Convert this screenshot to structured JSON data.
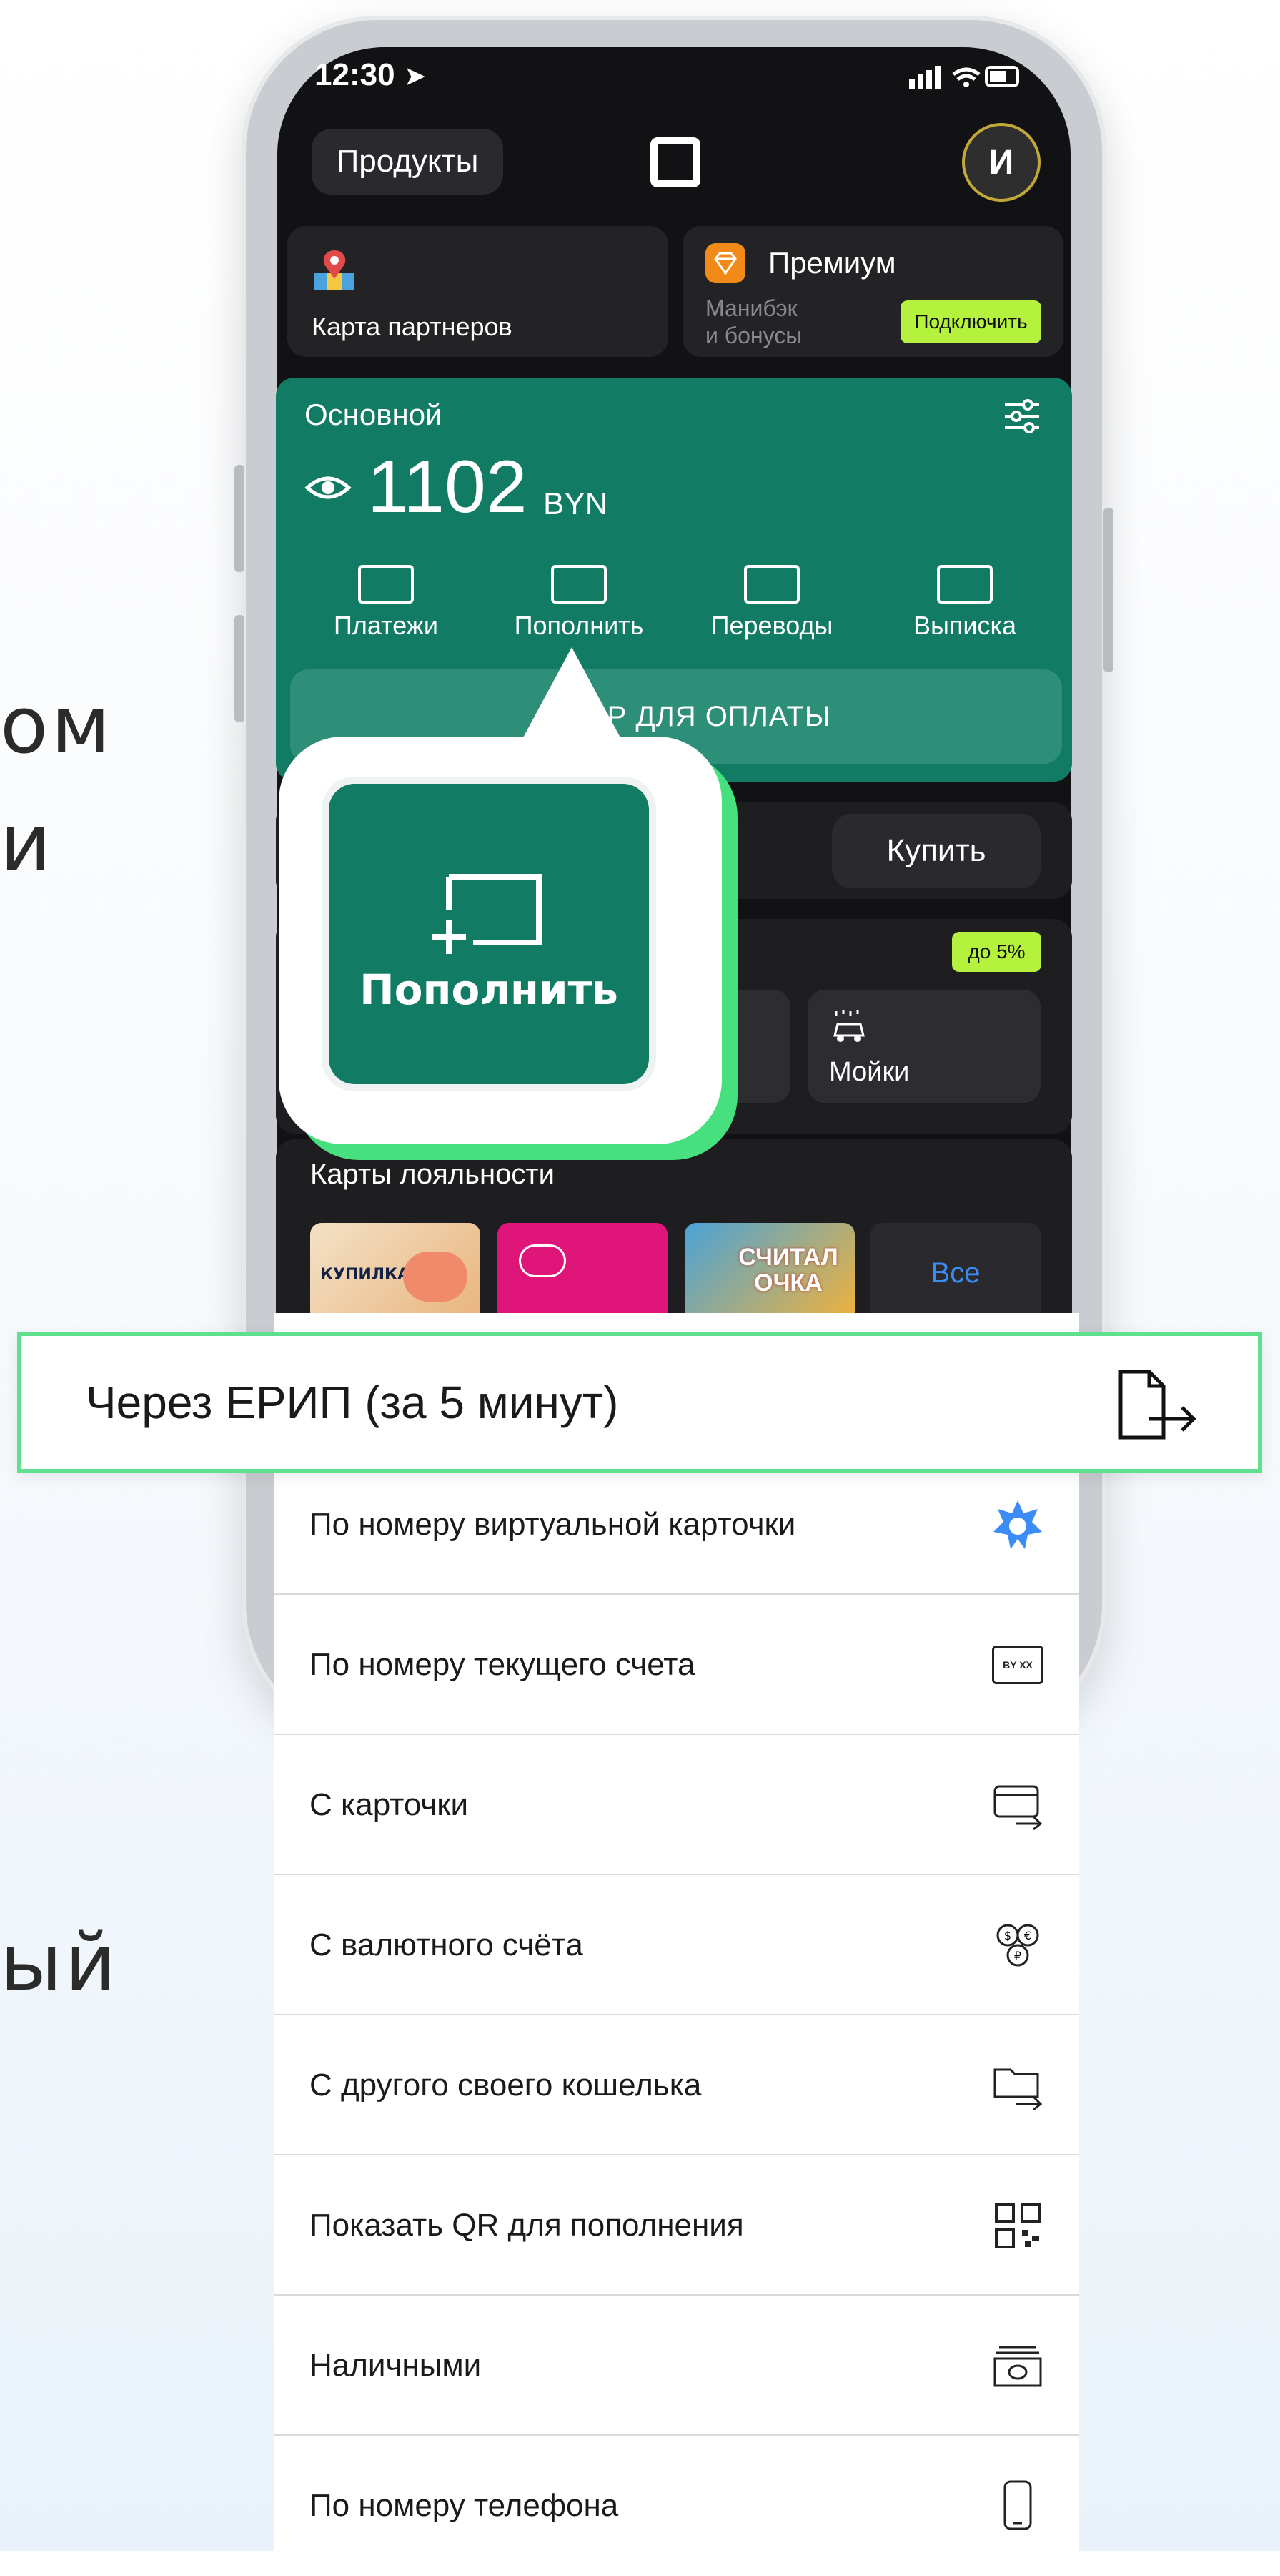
{
  "background_text": [
    "ом",
    "и",
    "ый"
  ],
  "status_bar": {
    "time": "12:30"
  },
  "header": {
    "products_label": "Продукты",
    "avatar_letter": "И"
  },
  "partners_tile": {
    "label": "Карта партнеров"
  },
  "premium_tile": {
    "title": "Премиум",
    "subtitle_line1": "Манибэк",
    "subtitle_line2": "и бонусы",
    "connect_label": "Подключить"
  },
  "wallet": {
    "name": "Основной",
    "balance": "1102",
    "currency": "BYN",
    "actions": [
      {
        "label": "Платежи"
      },
      {
        "label": "Пополнить"
      },
      {
        "label": "Переводы"
      },
      {
        "label": "Выписка"
      }
    ],
    "pay_button_text": "Р ДЛЯ ОПЛАТЫ"
  },
  "buy_card": {
    "buy_label": "Купить"
  },
  "cashback": {
    "badge": "до 5%",
    "tile_label": "Мойки"
  },
  "loyalty": {
    "title": "Карты лояльности",
    "all_label": "Все",
    "card1_text": "КУПИЛКА",
    "card3_text": "СЧИТАЛОЧКА"
  },
  "zoom": {
    "label": "Пополнить"
  },
  "topup_menu": {
    "highlighted": "Через ЕРИП (за 5 минут)",
    "items": [
      {
        "label": "По номеру виртуальной карточки",
        "icon": "snowflake-star-icon"
      },
      {
        "label": "По номеру текущего счета",
        "icon": "account-number-icon"
      },
      {
        "label": "С карточки",
        "icon": "card-transfer-icon"
      },
      {
        "label": "С валютного счёта",
        "icon": "currency-coins-icon"
      },
      {
        "label": "С другого своего кошелька",
        "icon": "wallet-transfer-icon"
      },
      {
        "label": "Показать QR для пополнения",
        "icon": "qr-code-icon"
      },
      {
        "label": "Наличными",
        "icon": "cash-icon"
      },
      {
        "label": "По номеру телефона",
        "icon": "phone-icon"
      }
    ],
    "account_icon_text": "BY XX"
  },
  "colors": {
    "wallet_green": "#127b63",
    "accent_lime": "#b5f23e",
    "highlight_green": "#5ee08f",
    "screen_bg": "#121214"
  }
}
